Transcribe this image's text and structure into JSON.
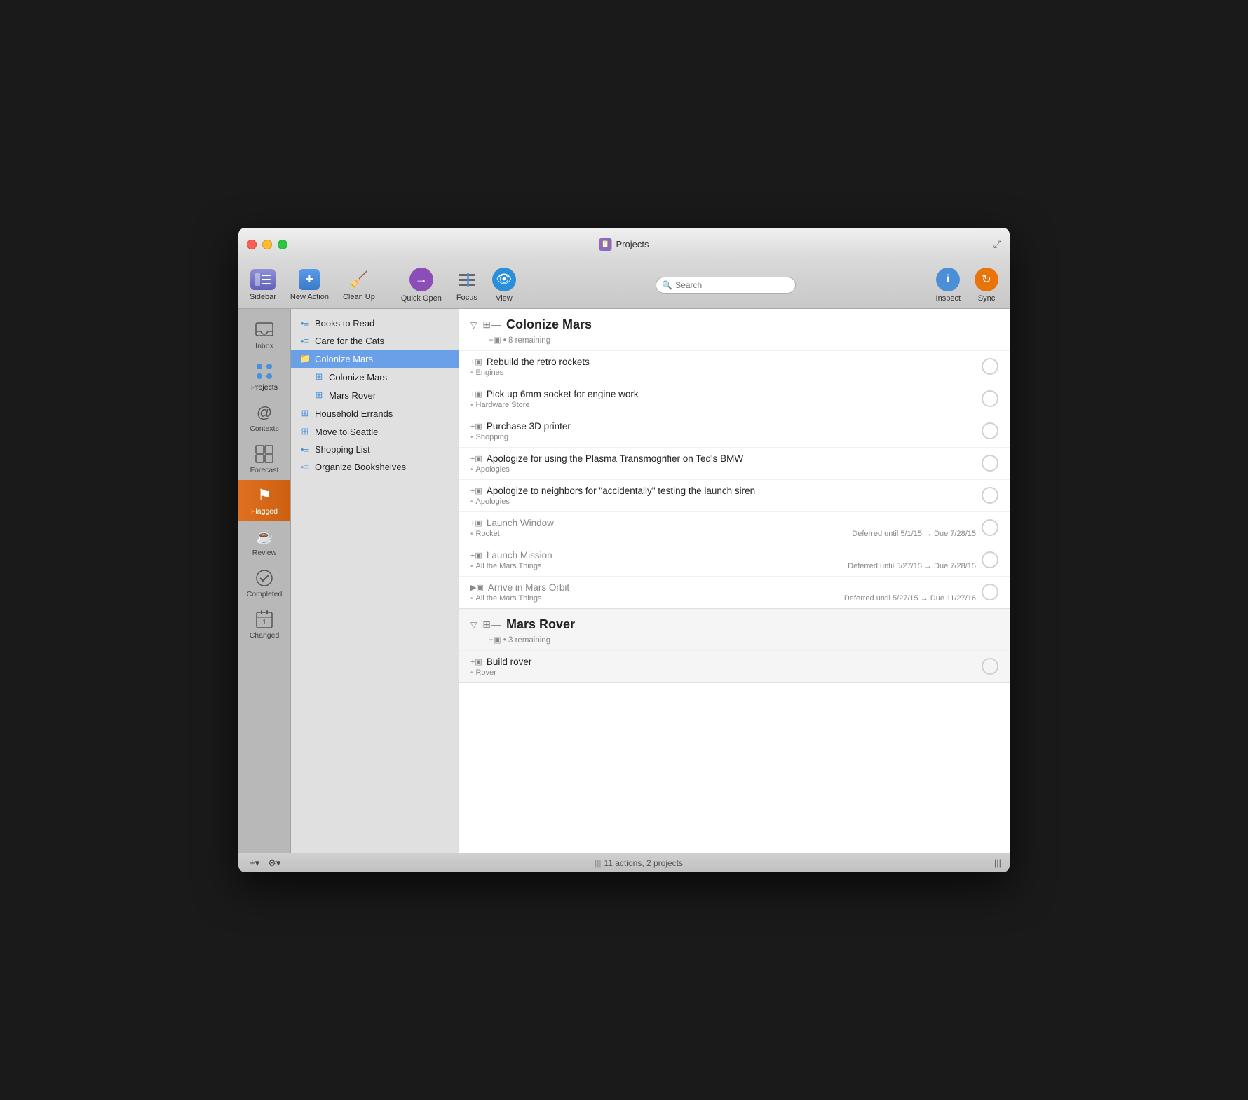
{
  "window": {
    "title": "Projects",
    "title_icon": "📋"
  },
  "toolbar": {
    "sidebar_label": "Sidebar",
    "new_action_label": "New Action",
    "clean_up_label": "Clean Up",
    "quick_open_label": "Quick Open",
    "focus_label": "Focus",
    "view_label": "View",
    "search_placeholder": "Search",
    "inspect_label": "Inspect",
    "sync_label": "Sync"
  },
  "sidebar_icons": [
    {
      "id": "inbox",
      "label": "Inbox",
      "icon": "✉",
      "active": false
    },
    {
      "id": "projects",
      "label": "Projects",
      "icon": "⠿",
      "active": true
    },
    {
      "id": "contexts",
      "label": "Contexts",
      "icon": "@",
      "active": false
    },
    {
      "id": "forecast",
      "label": "Forecast",
      "icon": "⊞",
      "active": false
    },
    {
      "id": "flagged",
      "label": "Flagged",
      "icon": "⚑",
      "active": false,
      "flagged": true
    },
    {
      "id": "review",
      "label": "Review",
      "icon": "☕",
      "active": false
    },
    {
      "id": "completed",
      "label": "Completed",
      "icon": "✓",
      "active": false
    },
    {
      "id": "changed",
      "label": "Changed",
      "icon": "📅",
      "active": false
    }
  ],
  "projects": [
    {
      "id": "books",
      "label": "Books to Read",
      "icon": "•≡",
      "indent": 0,
      "selected": false
    },
    {
      "id": "cats",
      "label": "Care for the Cats",
      "icon": "•≡",
      "indent": 0,
      "selected": false
    },
    {
      "id": "colonize",
      "label": "Colonize Mars",
      "icon": "📁",
      "indent": 0,
      "selected": true
    },
    {
      "id": "colonize-sub",
      "label": "Colonize Mars",
      "icon": "≡≡",
      "indent": 1,
      "selected": false
    },
    {
      "id": "marsrover",
      "label": "Mars Rover",
      "icon": "≡≡",
      "indent": 1,
      "selected": false
    },
    {
      "id": "household",
      "label": "Household Errands",
      "icon": "≡≡",
      "indent": 0,
      "selected": false
    },
    {
      "id": "seattle",
      "label": "Move to Seattle",
      "icon": "≡≡",
      "indent": 0,
      "selected": false
    },
    {
      "id": "shopping",
      "label": "Shopping List",
      "icon": "•≡",
      "indent": 0,
      "selected": false
    },
    {
      "id": "bookshelves",
      "label": "Organize Bookshelves",
      "icon": "•≡",
      "indent": 0,
      "selected": false
    }
  ],
  "task_groups": [
    {
      "id": "colonize-mars-group",
      "title": "Colonize Mars",
      "remaining": "8 remaining",
      "tasks": [
        {
          "id": "t1",
          "title": "Rebuild the retro rockets",
          "context": "Engines",
          "deferred": false,
          "has_note": true,
          "date_info": ""
        },
        {
          "id": "t2",
          "title": "Pick up 6mm socket for engine work",
          "context": "Hardware Store",
          "deferred": false,
          "has_note": true,
          "date_info": ""
        },
        {
          "id": "t3",
          "title": "Purchase 3D printer",
          "context": "Shopping",
          "deferred": false,
          "has_note": true,
          "date_info": ""
        },
        {
          "id": "t4",
          "title": "Apologize for using the Plasma Transmogrifier on Ted's BMW",
          "context": "Apologies",
          "deferred": false,
          "has_note": true,
          "date_info": ""
        },
        {
          "id": "t5",
          "title": "Apologize to neighbors for “accidentally” testing the launch siren",
          "context": "Apologies",
          "deferred": false,
          "has_note": true,
          "date_info": ""
        },
        {
          "id": "t6",
          "title": "Launch Window",
          "context": "Rocket",
          "deferred": true,
          "has_note": true,
          "date_info": "Deferred until 5/1/15 → Due 7/28/15"
        },
        {
          "id": "t7",
          "title": "Launch Mission",
          "context": "All the Mars Things",
          "deferred": true,
          "has_note": true,
          "date_info": "Deferred until 5/27/15 → Due 7/28/15"
        },
        {
          "id": "t8",
          "title": "Arrive in Mars Orbit",
          "context": "All the Mars Things",
          "deferred": true,
          "has_note": true,
          "date_info": "Deferred until 5/27/15 → Due 11/27/16"
        }
      ]
    },
    {
      "id": "mars-rover-group",
      "title": "Mars Rover",
      "remaining": "3 remaining",
      "tasks": [
        {
          "id": "t9",
          "title": "Build rover",
          "context": "Rover",
          "deferred": false,
          "has_note": true,
          "date_info": ""
        }
      ]
    }
  ],
  "statusbar": {
    "add_label": "+",
    "gear_label": "⚙",
    "status_text": "11 actions, 2 projects",
    "bars_icon": "|||"
  }
}
